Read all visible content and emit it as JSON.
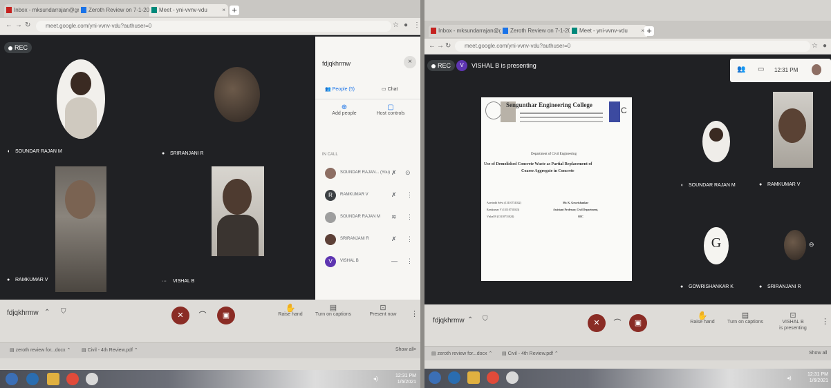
{
  "left": {
    "tabs": [
      "Inbox - mksundarrajan@gmail.com",
      "Zeroth Review on 7-1-2021",
      "Meet - yni-vvnv-vdu"
    ],
    "url": "meet.google.com/yni-vvnv-vdu?authuser=0",
    "rec": "REC",
    "tiles": [
      {
        "name": "SOUNDAR RAJAN M"
      },
      {
        "name": "SRIRANJANI R"
      },
      {
        "name": "RAMKUMAR V"
      },
      {
        "name": "VISHAL B"
      }
    ],
    "panel": {
      "meeting_code": "fdjqkhrmw",
      "tab_people": "People (5)",
      "tab_chat": "Chat",
      "add_people": "Add people",
      "host_controls": "Host controls",
      "in_call": "IN CALL",
      "participants": [
        {
          "initial": "",
          "name": "SOUNDAR RAJAN... (You)",
          "color": "#8d6e63"
        },
        {
          "initial": "R",
          "name": "RAMKUMAR V",
          "color": "#3c4043"
        },
        {
          "initial": "",
          "name": "SOUNDAR RAJAN M",
          "color": "#9e9e9e"
        },
        {
          "initial": "",
          "name": "SRIRANJANI R",
          "color": "#5d4037"
        },
        {
          "initial": "V",
          "name": "VISHAL B",
          "color": "#5e35b1"
        }
      ]
    },
    "bottom": {
      "meeting_code": "fdjqkhrmw",
      "raise_hand": "Raise hand",
      "captions": "Turn on captions",
      "present": "Present now"
    },
    "downloads": [
      "zeroth review for...docx",
      "Civil - 4th Review.pdf"
    ],
    "show_all": "Show all",
    "clock_time": "12:31 PM",
    "clock_date": "1/6/2021"
  },
  "right": {
    "tabs": [
      "Inbox - mksundarrajan@gmail.com",
      "Zeroth Review on 7-1-2021",
      "Meet - yni-vvnv-vdu"
    ],
    "url": "meet.google.com/yni-vvnv-vdu?authuser=0",
    "rec": "REC",
    "presenter_initial": "V",
    "presenting": "VISHAL B is presenting",
    "top_time": "12:31 PM",
    "slide": {
      "college": "Sengunthar Engineering College",
      "department": "Department of Civil Engineering",
      "title_line1": "Use of Demolished Concrete Waste as Partial Replacement of",
      "title_line2": "Coarse Aggregate in Concrete",
      "students": [
        "Aravindh Selvi (13110731022)",
        "Ramkumar V (13110731023)",
        "Vishal B (13110731024)"
      ],
      "guide": "Mr. K. Gowrishankar",
      "guide_role": "Assistant Professor, Civil Department,",
      "guide_org": "SEC"
    },
    "tiles": [
      {
        "name": "SOUNDAR RAJAN M"
      },
      {
        "name": "RAMKUMAR V"
      },
      {
        "name": "GOWRISHANKAR K"
      },
      {
        "name": "SRIRANJANI R"
      }
    ],
    "bottom": {
      "meeting_code": "fdjqkhrmw",
      "raise_hand": "Raise hand",
      "captions": "Turn on captions",
      "presenting_line1": "VISHAL B",
      "presenting_line2": "is presenting"
    },
    "downloads": [
      "zeroth review for...docx",
      "Civil - 4th Review.pdf"
    ],
    "show_all": "Show all",
    "clock_time": "12:31 PM",
    "clock_date": "1/6/2021"
  }
}
